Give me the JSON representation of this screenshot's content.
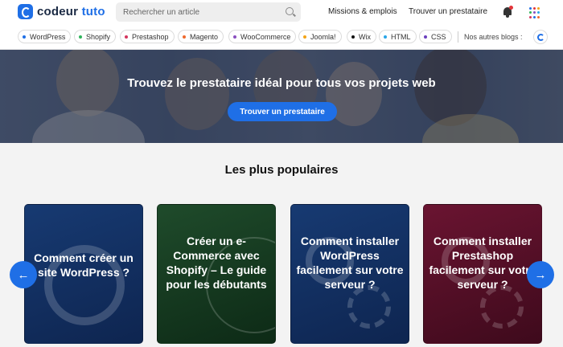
{
  "header": {
    "logo_text_main": "codeur",
    "logo_text_accent": "tuto",
    "search_placeholder": "Rechercher un article",
    "nav": [
      "Missions & emplois",
      "Trouver un prestataire"
    ]
  },
  "tags": [
    {
      "label": "WordPress",
      "color": "#1f6fe6"
    },
    {
      "label": "Shopify",
      "color": "#2fb55b"
    },
    {
      "label": "Prestashop",
      "color": "#d4355d"
    },
    {
      "label": "Magento",
      "color": "#ef6a2e"
    },
    {
      "label": "WooCommerce",
      "color": "#8a4fbf"
    },
    {
      "label": "Joomla!",
      "color": "#f3a417"
    },
    {
      "label": "Wix",
      "color": "#111111"
    },
    {
      "label": "HTML",
      "color": "#29a6e8"
    },
    {
      "label": "CSS",
      "color": "#6b3fbd"
    }
  ],
  "other_blogs_label": "Nos autres blogs :",
  "hero": {
    "title": "Trouvez le prestataire idéal pour tous vos projets web",
    "button_label": "Trouver un prestataire"
  },
  "section_title": "Les plus populaires",
  "cards": [
    {
      "title": "Comment créer un site WordPress ?",
      "color_top": "#173a72",
      "color_bottom": "#0e2550"
    },
    {
      "title": "Créer un e-Commerce avec Shopify – Le guide pour les débutants",
      "color_top": "#1f4b2b",
      "color_bottom": "#0d2a16"
    },
    {
      "title": "Comment installer WordPress facilement sur votre serveur ?",
      "color_top": "#173a72",
      "color_bottom": "#0e2550"
    },
    {
      "title": "Comment installer Prestashop facilement sur votre serveur ?",
      "color_top": "#6a1431",
      "color_bottom": "#3e0a1c"
    }
  ],
  "carousel": {
    "prev_arrow": "←",
    "next_arrow": "→"
  }
}
